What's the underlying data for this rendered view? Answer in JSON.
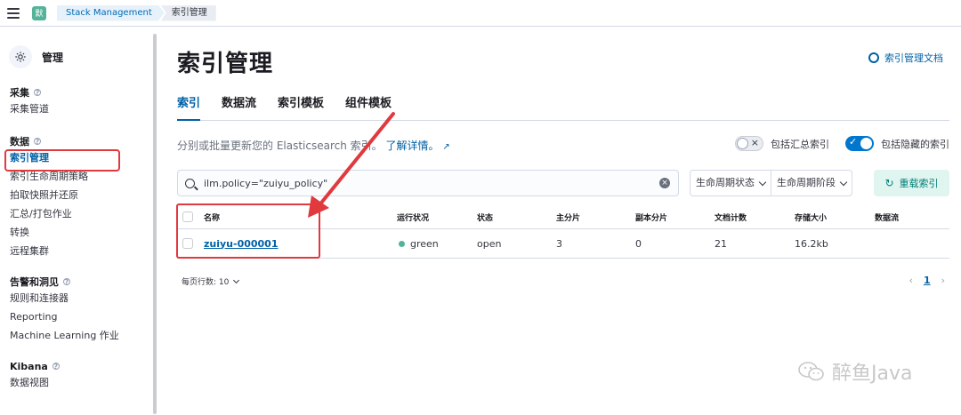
{
  "topbar": {
    "avatar_text": "默",
    "breadcrumb": [
      "Stack Management",
      "索引管理"
    ]
  },
  "sidebar": {
    "title": "管理",
    "groups": [
      {
        "title": "采集",
        "items": [
          "采集管道"
        ]
      },
      {
        "title": "数据",
        "items": [
          "索引管理",
          "索引生命周期策略",
          "拍取快照并还原",
          "汇总/打包作业",
          "转换",
          "远程集群"
        ]
      },
      {
        "title": "告警和洞见",
        "items": [
          "规则和连接器",
          "Reporting",
          "Machine Learning 作业"
        ]
      },
      {
        "title": "Kibana",
        "items": [
          "数据视图"
        ]
      }
    ]
  },
  "main": {
    "title": "索引管理",
    "doc_link": "索引管理文档",
    "tabs": [
      "索引",
      "数据流",
      "索引模板",
      "组件模板"
    ],
    "description": "分别或批量更新您的 Elasticsearch 索引。",
    "learn_more": "了解详情。",
    "toggles": {
      "rollup": "包括汇总索引",
      "hidden": "包括隐藏的索引"
    },
    "search_value": "ilm.policy=\"zuiyu_policy\"",
    "filters": [
      "生命周期状态",
      "生命周期阶段"
    ],
    "reload_label": "重载索引",
    "columns": [
      "名称",
      "运行状况",
      "状态",
      "主分片",
      "副本分片",
      "文档计数",
      "存储大小",
      "数据流"
    ],
    "rows": [
      {
        "name": "zuiyu-000001",
        "health": "green",
        "status": "open",
        "primary": "3",
        "replica": "0",
        "docs": "21",
        "size": "16.2kb",
        "stream": ""
      }
    ],
    "rows_per_page": "每页行数: 10",
    "page": "1"
  },
  "watermark": "醉鱼Java",
  "colors": {
    "accent": "#0061a6",
    "highlight": "#e0393e",
    "health_green": "#54b399"
  }
}
